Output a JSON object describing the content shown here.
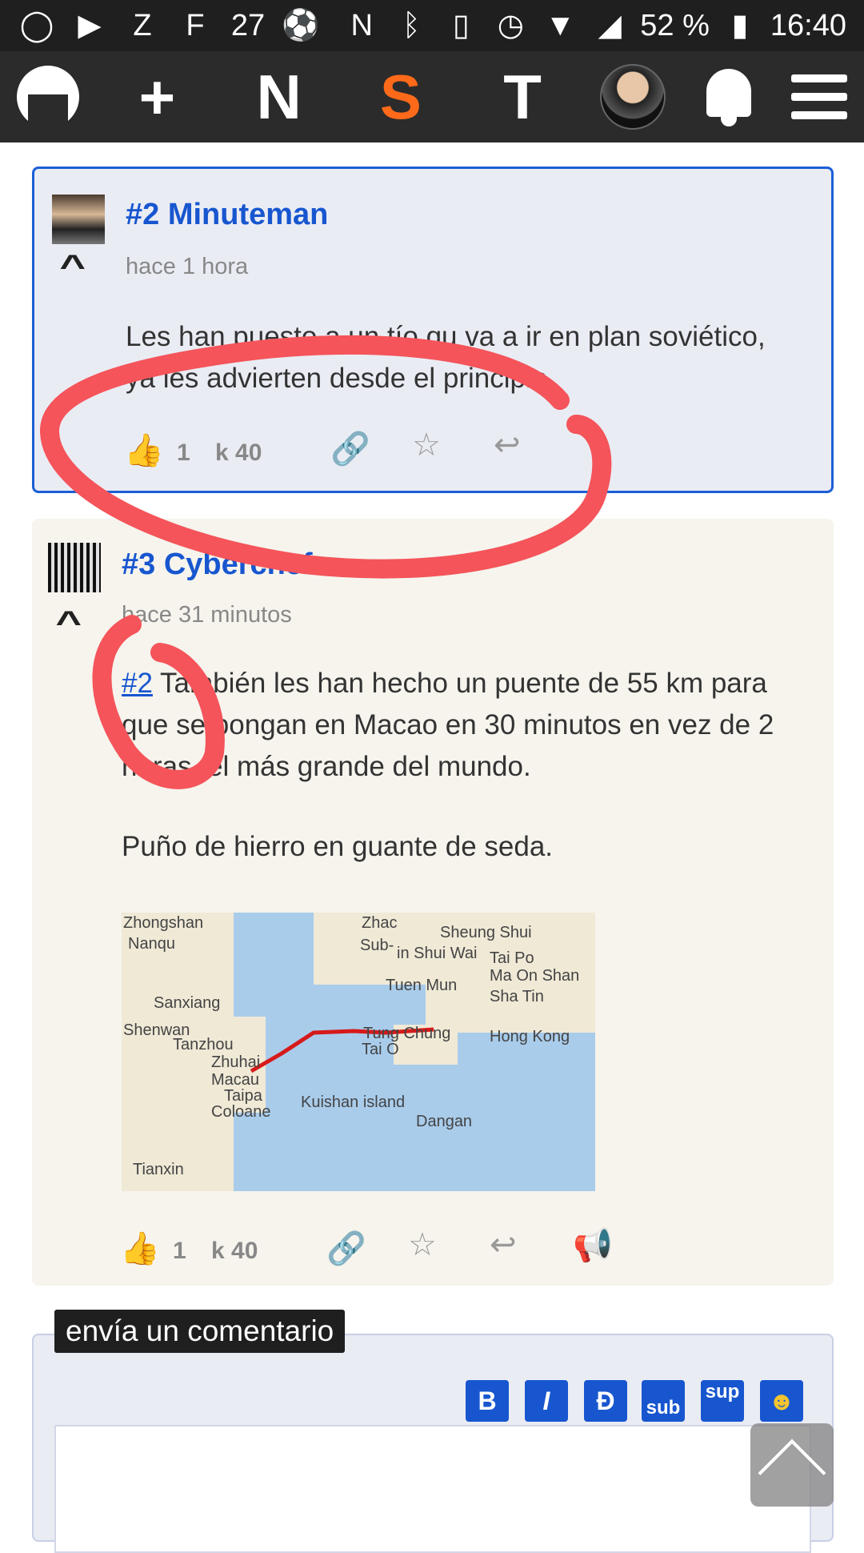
{
  "status_bar": {
    "left_icons": [
      "whatsapp-icon",
      "youtube-icon",
      "z-app-icon",
      "fc-app-icon",
      "27-icon",
      "soccer-ball-icon"
    ],
    "day_text": "27",
    "battery": "52 %",
    "time": "16:40"
  },
  "nav": {
    "items": [
      "N",
      "S",
      "T"
    ],
    "active": "S"
  },
  "comments": [
    {
      "title": "#2 Minuteman",
      "time": "hace 1 hora",
      "text": "Les han puesto a un tío qu va a ir en plan soviético, ya les advierten desde el principio.",
      "votes": "1",
      "karma": "k 40"
    },
    {
      "title": "#3 Cyberchef",
      "time": "hace 31 minutos",
      "link": "#2",
      "text_line1": " También les han hecho un puente de 55 km para que se pongan en Macao en 30 minutos en vez de 2 horas, el más grande del mundo.",
      "text_line2": "Puño de hierro en guante de seda.",
      "votes": "1",
      "karma": "k 40",
      "map_labels": [
        "Zhongshan",
        "Nanqu",
        "Zhac",
        "Sub-",
        "in Shui Wai",
        "Sheung Shui",
        "Tai Po",
        "Ma On Shan",
        "Tuen Mun",
        "Sha Tin",
        "Sanxiang",
        "Shenwan",
        "Tanzhou",
        "Zhuhai",
        "Macau",
        "Taipa",
        "Coloane",
        "Tung Chung",
        "Tai O",
        "Hong Kong",
        "Kuishan island",
        "Dangan",
        "Tianxin"
      ]
    }
  ],
  "compose": {
    "label": "envía un comentario",
    "buttons": [
      "B",
      "I",
      "Đ",
      "sub",
      "sup",
      "☻"
    ]
  },
  "colors": {
    "link_blue": "#1756cf",
    "active_nav": "#ff6a1a",
    "annotation": "#f4545a"
  }
}
